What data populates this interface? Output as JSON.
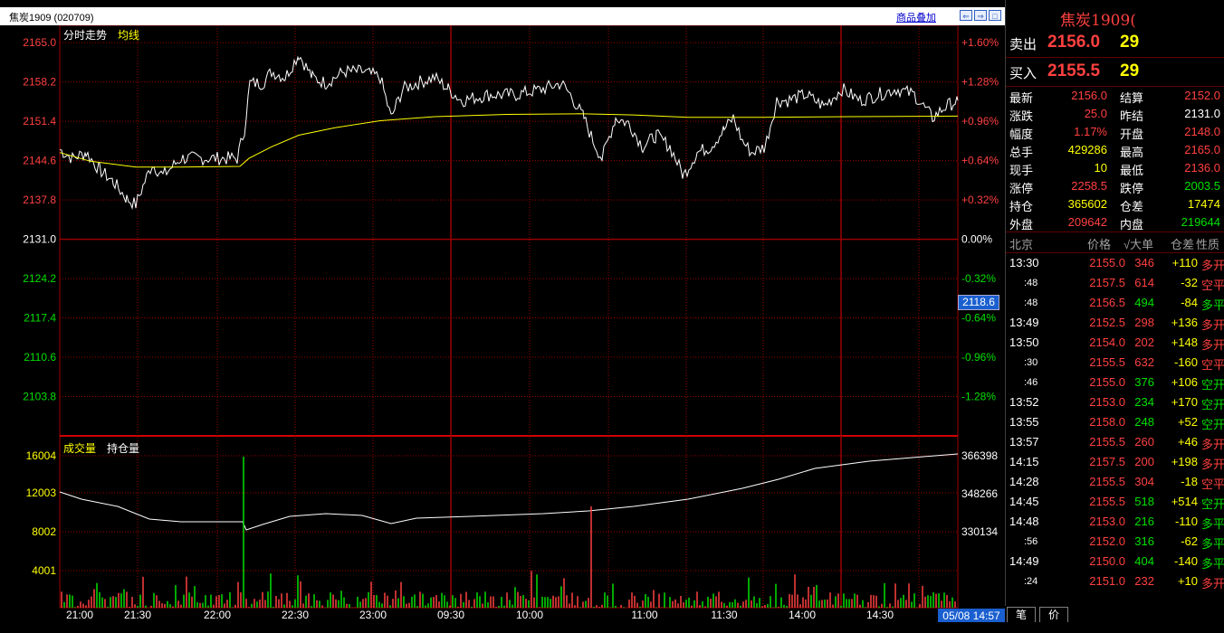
{
  "header": {
    "contract_title": "焦炭1909 (020709)",
    "overlay_link": "商品叠加"
  },
  "price_chart": {
    "legend_intraday": "分时走势",
    "legend_avg": "均线",
    "left_ticks": [
      "2165.0",
      "2158.2",
      "2151.4",
      "2144.6",
      "2137.8",
      "2131.0",
      "2124.2",
      "2117.4",
      "2110.6",
      "2103.8"
    ],
    "right_ticks": [
      "+1.60%",
      "+1.28%",
      "+0.96%",
      "+0.64%",
      "+0.32%",
      "0.00%",
      "-0.32%",
      "-0.64%",
      "-0.96%",
      "-1.28%"
    ],
    "cursor_value": "2118.6",
    "prev_close": 2131.0,
    "y_max": 2168.0,
    "y_min": 2097.0
  },
  "volume_chart": {
    "legend_volume": "成交量",
    "legend_oi": "持仓量",
    "left_ticks": [
      "16004",
      "12003",
      "8002",
      "4001"
    ],
    "right_ticks": [
      "366398",
      "348266",
      "330134"
    ]
  },
  "time_axis": [
    "21:00",
    "21:30",
    "22:00",
    "22:30",
    "23:00",
    "09:30",
    "10:00",
    "11:00",
    "11:30",
    "14:00",
    "14:30"
  ],
  "time_badge": "05/08 14:57",
  "quote": {
    "name": "焦炭1909(",
    "ask_label": "卖出",
    "ask_price": "2156.0",
    "ask_vol": "29",
    "bid_label": "买入",
    "bid_price": "2155.5",
    "bid_vol": "29",
    "rows": [
      {
        "l1": "最新",
        "v1": "2156.0",
        "c1": "red",
        "l2": "结算",
        "v2": "2152.0",
        "c2": "red"
      },
      {
        "l1": "涨跌",
        "v1": "25.0",
        "c1": "red",
        "l2": "昨结",
        "v2": "2131.0",
        "c2": "white"
      },
      {
        "l1": "幅度",
        "v1": "1.17%",
        "c1": "red",
        "l2": "开盘",
        "v2": "2148.0",
        "c2": "red"
      },
      {
        "l1": "总手",
        "v1": "429286",
        "c1": "yellow",
        "l2": "最高",
        "v2": "2165.0",
        "c2": "red"
      },
      {
        "l1": "现手",
        "v1": "10",
        "c1": "yellow",
        "l2": "最低",
        "v2": "2136.0",
        "c2": "red"
      },
      {
        "l1": "涨停",
        "v1": "2258.5",
        "c1": "red",
        "l2": "跌停",
        "v2": "2003.5",
        "c2": "green"
      },
      {
        "l1": "持仓",
        "v1": "365602",
        "c1": "yellow",
        "l2": "仓差",
        "v2": "17474",
        "c2": "yellow"
      },
      {
        "l1": "外盘",
        "v1": "209642",
        "c1": "red",
        "l2": "内盘",
        "v2": "219644",
        "c2": "green"
      }
    ]
  },
  "trades": {
    "headers": [
      "北京",
      "价格",
      "√大单",
      "仓差",
      "性质"
    ],
    "rows": [
      {
        "time": "13:30",
        "price": "2155.0",
        "vol": "346",
        "vc": "red",
        "oi": "+110",
        "nature": "多开",
        "nc": "red"
      },
      {
        "time": ":48",
        "price": "2157.5",
        "vol": "614",
        "vc": "red",
        "oi": "-32",
        "nature": "空平",
        "nc": "red"
      },
      {
        "time": ":48",
        "price": "2156.5",
        "vol": "494",
        "vc": "green",
        "oi": "-84",
        "nature": "多平",
        "nc": "green"
      },
      {
        "time": "13:49",
        "price": "2152.5",
        "vol": "298",
        "vc": "red",
        "oi": "+136",
        "nature": "多开",
        "nc": "red"
      },
      {
        "time": "13:50",
        "price": "2154.0",
        "vol": "202",
        "vc": "red",
        "oi": "+148",
        "nature": "多开",
        "nc": "red"
      },
      {
        "time": ":30",
        "price": "2155.5",
        "vol": "632",
        "vc": "red",
        "oi": "-160",
        "nature": "空平",
        "nc": "red"
      },
      {
        "time": ":46",
        "price": "2155.0",
        "vol": "376",
        "vc": "green",
        "oi": "+106",
        "nature": "空开",
        "nc": "green"
      },
      {
        "time": "13:52",
        "price": "2153.0",
        "vol": "234",
        "vc": "green",
        "oi": "+170",
        "nature": "空开",
        "nc": "green"
      },
      {
        "time": "13:55",
        "price": "2158.0",
        "vol": "248",
        "vc": "green",
        "oi": "+52",
        "nature": "空开",
        "nc": "green"
      },
      {
        "time": "13:57",
        "price": "2155.5",
        "vol": "260",
        "vc": "red",
        "oi": "+46",
        "nature": "多开",
        "nc": "red"
      },
      {
        "time": "14:15",
        "price": "2157.5",
        "vol": "200",
        "vc": "red",
        "oi": "+198",
        "nature": "多开",
        "nc": "red"
      },
      {
        "time": "14:28",
        "price": "2155.5",
        "vol": "304",
        "vc": "red",
        "oi": "-18",
        "nature": "空平",
        "nc": "red"
      },
      {
        "time": "14:45",
        "price": "2155.5",
        "vol": "518",
        "vc": "green",
        "oi": "+514",
        "nature": "空开",
        "nc": "green"
      },
      {
        "time": "14:48",
        "price": "2153.0",
        "vol": "216",
        "vc": "green",
        "oi": "-110",
        "nature": "多平",
        "nc": "green"
      },
      {
        "time": ":56",
        "price": "2152.0",
        "vol": "316",
        "vc": "green",
        "oi": "-62",
        "nature": "多平",
        "nc": "green"
      },
      {
        "time": "14:49",
        "price": "2150.0",
        "vol": "404",
        "vc": "green",
        "oi": "-140",
        "nature": "多平",
        "nc": "green"
      },
      {
        "time": ":24",
        "price": "2151.0",
        "vol": "232",
        "vc": "red",
        "oi": "+10",
        "nature": "多开",
        "nc": "red"
      }
    ]
  },
  "tabs": [
    "笔",
    "价"
  ],
  "colors": {
    "up": "#ff4040",
    "down": "#00e000",
    "grid": "#9a0000",
    "avg": "#ffff00",
    "price": "#ffffff"
  }
}
